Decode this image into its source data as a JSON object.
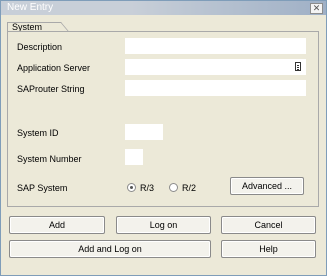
{
  "window": {
    "title": "New Entry",
    "close_glyph": "✕"
  },
  "system_group": {
    "tab_label": "System",
    "description": {
      "label": "Description",
      "value": ""
    },
    "application_server": {
      "label": "Application Server",
      "value": ""
    },
    "saprouter_string": {
      "label": "SAProuter String",
      "value": ""
    },
    "system_id": {
      "label": "System ID",
      "value": ""
    },
    "system_number": {
      "label": "System Number",
      "value": ""
    },
    "sap_system": {
      "label": "SAP System",
      "options": [
        {
          "label": "R/3",
          "selected": true
        },
        {
          "label": "R/2",
          "selected": false
        }
      ]
    },
    "advanced_button": {
      "label": "Advanced ..."
    }
  },
  "buttons": {
    "add": "Add",
    "log_on": "Log on",
    "cancel": "Cancel",
    "add_and_log_on": "Add and Log on",
    "help": "Help"
  }
}
